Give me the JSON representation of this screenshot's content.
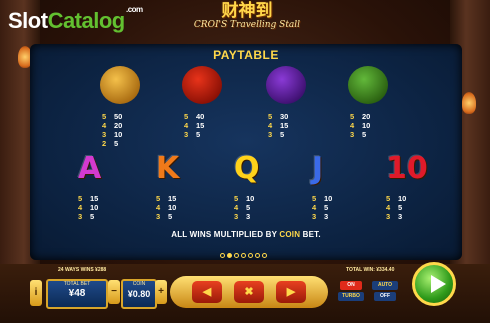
{
  "watermark": {
    "slot": "Slot",
    "catalog": "Catalog",
    "com": ".com"
  },
  "game_logo": {
    "cn": "财神到",
    "en": "CROI'S Travelling Stall"
  },
  "paytable": {
    "title": "PAYTABLE",
    "high_symbols": [
      {
        "name": "gold-coin-pouch",
        "counts": [
          "5",
          "4",
          "3",
          "2"
        ],
        "values": [
          "50",
          "20",
          "10",
          "5"
        ]
      },
      {
        "name": "red-phoenix",
        "counts": [
          "5",
          "4",
          "3"
        ],
        "values": [
          "40",
          "15",
          "5"
        ]
      },
      {
        "name": "purple-doll",
        "counts": [
          "5",
          "4",
          "3"
        ],
        "values": [
          "30",
          "15",
          "5"
        ]
      },
      {
        "name": "green-frog",
        "counts": [
          "5",
          "4",
          "3"
        ],
        "values": [
          "20",
          "10",
          "5"
        ]
      }
    ],
    "low_symbols": [
      {
        "glyph": "A",
        "color": "#d33ad0",
        "counts": [
          "5",
          "4",
          "3"
        ],
        "values": [
          "15",
          "10",
          "5"
        ]
      },
      {
        "glyph": "K",
        "color": "#f07a1a",
        "counts": [
          "5",
          "4",
          "3"
        ],
        "values": [
          "15",
          "10",
          "5"
        ]
      },
      {
        "glyph": "Q",
        "color": "#ffd21a",
        "counts": [
          "5",
          "4",
          "3"
        ],
        "values": [
          "10",
          "5",
          "3"
        ]
      },
      {
        "glyph": "J",
        "color": "#3a6ae8",
        "counts": [
          "5",
          "4",
          "3"
        ],
        "values": [
          "10",
          "5",
          "3"
        ]
      },
      {
        "glyph": "10",
        "color": "#e01a2a",
        "counts": [
          "5",
          "4",
          "3"
        ],
        "values": [
          "10",
          "5",
          "3"
        ]
      }
    ],
    "note_prefix": "ALL WINS MULTIPLIED BY ",
    "note_coin": "COIN",
    "note_suffix": " BET.",
    "page_dots": 7,
    "active_dot": 1
  },
  "bottom": {
    "ways": "24 WAYS WINS ¥288",
    "total_win": "TOTAL WIN: ¥334.40",
    "info": "i",
    "total_bet_label": "TOTAL BET",
    "total_bet": "¥48",
    "minus": "−",
    "plus": "+",
    "coin_label": "COIN",
    "coin": "¥0.80",
    "prev": "◀",
    "close": "✖",
    "next": "▶",
    "on": "ON",
    "turbo": "TURBO",
    "auto": "AUTO",
    "off": "OFF"
  }
}
